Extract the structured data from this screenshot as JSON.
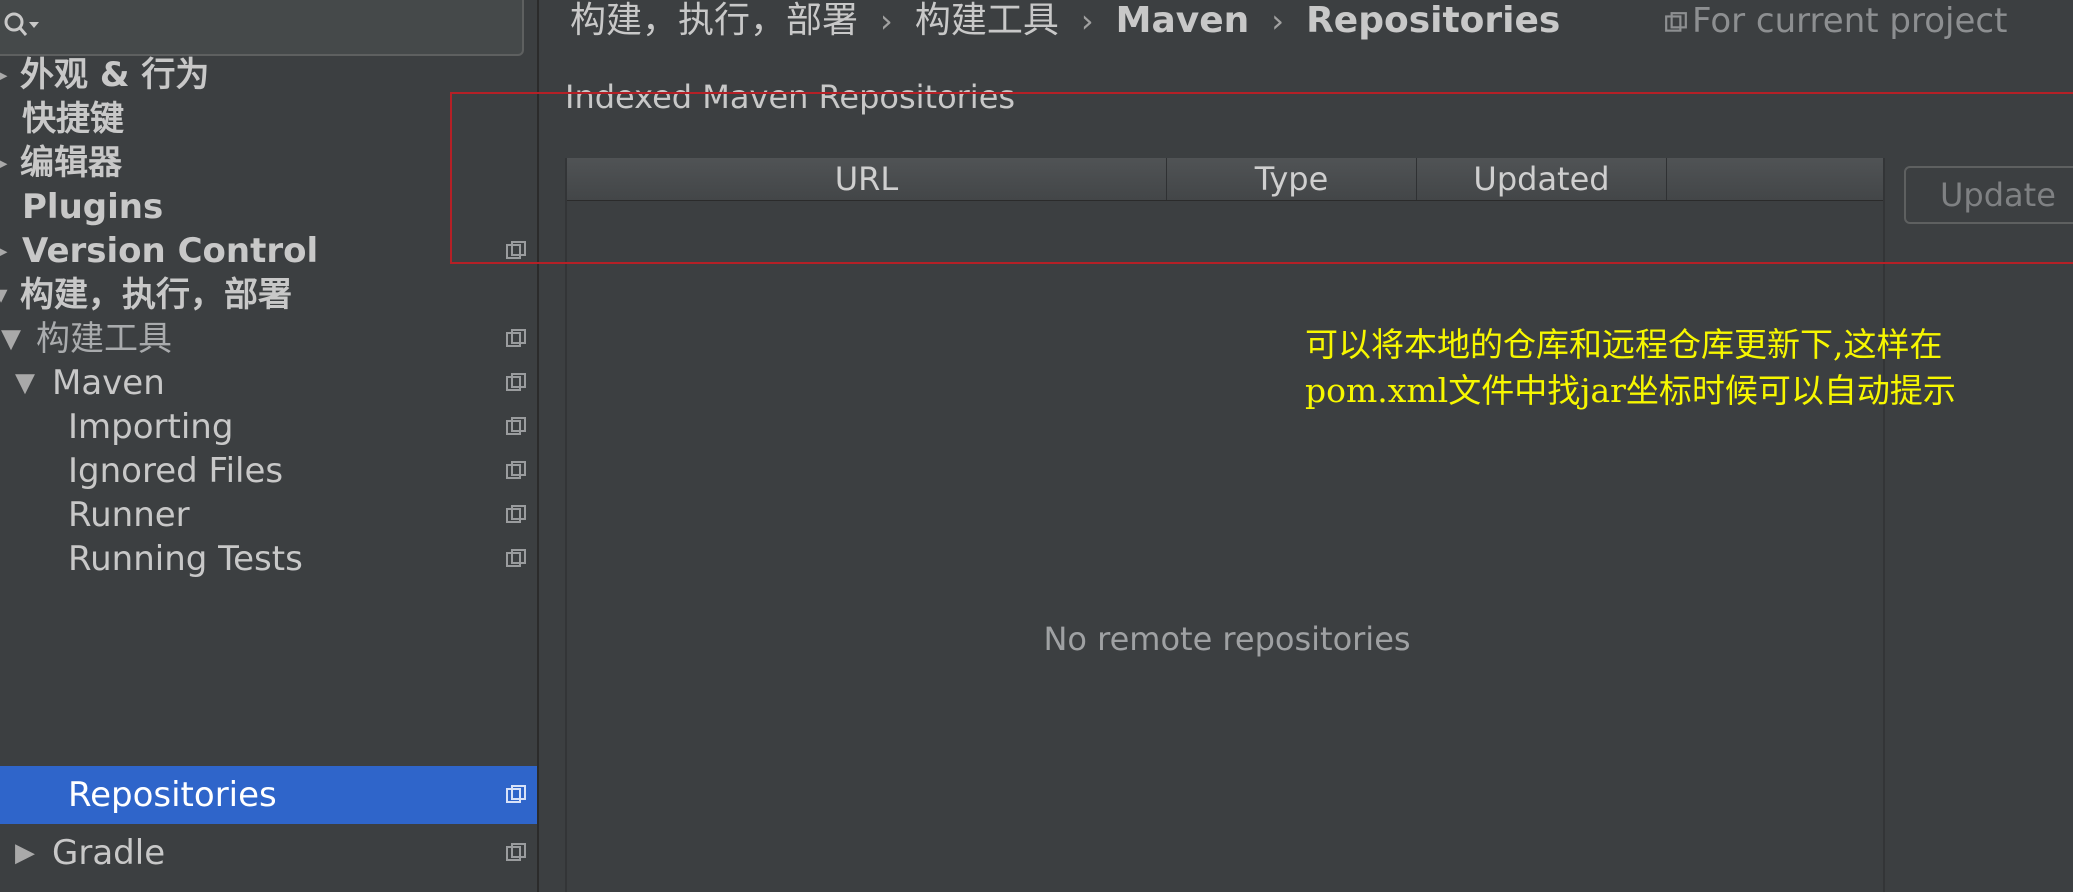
{
  "search": {
    "value": ""
  },
  "sidebar": {
    "items": [
      {
        "label": "外观 & 行为",
        "arrow": "▸"
      },
      {
        "label": "快捷键"
      },
      {
        "label": "编辑器",
        "arrow": "▸"
      },
      {
        "label": "Plugins"
      },
      {
        "label": "Version Control",
        "arrow": "▸"
      },
      {
        "label": "构建，执行，部署",
        "arrow": "▾"
      },
      {
        "label": "构建工具",
        "arrow": "▼"
      },
      {
        "label": "Maven",
        "arrow": "▼"
      },
      {
        "label": "Importing"
      },
      {
        "label": "Ignored Files"
      },
      {
        "label": "Runner"
      },
      {
        "label": "Running Tests"
      },
      {
        "label": "Repositories"
      },
      {
        "label": "Gradle",
        "arrow": "▶"
      }
    ]
  },
  "breadcrumb": {
    "items": [
      "构建，执行，部署",
      "构建工具",
      "Maven",
      "Repositories"
    ],
    "separator": "›",
    "scope": "For current project"
  },
  "section": {
    "title": "Indexed Maven Repositories"
  },
  "table": {
    "columns": [
      "URL",
      "Type",
      "Updated",
      ""
    ],
    "empty_text": "No remote repositories"
  },
  "update_button": {
    "label": "Update"
  },
  "annotation": {
    "line1": "可以将本地的仓库和远程仓库更新下,这样在",
    "line2": "pom.xml文件中找jar坐标时候可以自动提示"
  },
  "colors": {
    "background": "#3c3f41",
    "selection": "#2f65ca",
    "annotation_text": "#f7f700",
    "highlight_box": "#b52026"
  },
  "icons": {
    "search": "search-icon",
    "project_scope": "copy-icon"
  }
}
